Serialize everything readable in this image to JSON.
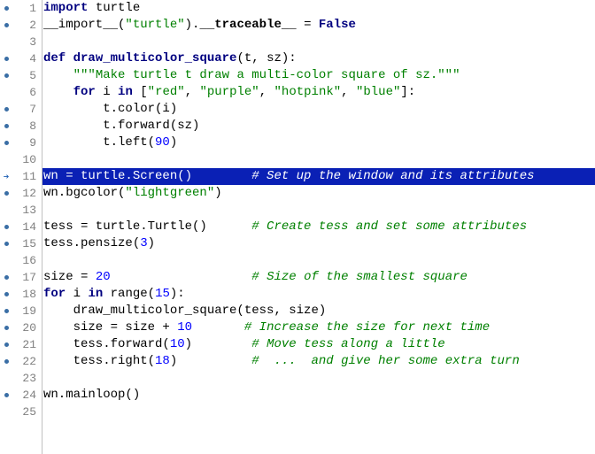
{
  "current_line": 11,
  "lines": [
    {
      "n": 1,
      "bp": true,
      "tokens": [
        [
          "k",
          "import"
        ],
        [
          "n",
          " turtle"
        ]
      ]
    },
    {
      "n": 2,
      "bp": true,
      "tokens": [
        [
          "n",
          "__import__("
        ],
        [
          "s",
          "\"turtle\""
        ],
        [
          "n",
          ")."
        ],
        [
          "bold",
          "__traceable__"
        ],
        [
          "n",
          " = "
        ],
        [
          "k",
          "False"
        ]
      ]
    },
    {
      "n": 3,
      "bp": false,
      "tokens": []
    },
    {
      "n": 4,
      "bp": true,
      "tokens": [
        [
          "k",
          "def"
        ],
        [
          "n",
          " "
        ],
        [
          "f",
          "draw_multicolor_square"
        ],
        [
          "n",
          "(t, sz):"
        ]
      ]
    },
    {
      "n": 5,
      "bp": true,
      "tokens": [
        [
          "n",
          "    "
        ],
        [
          "s",
          "\"\"\"Make turtle t draw a multi-color square of sz.\"\"\""
        ]
      ]
    },
    {
      "n": 6,
      "bp": false,
      "tokens": [
        [
          "n",
          "    "
        ],
        [
          "k",
          "for"
        ],
        [
          "n",
          " i "
        ],
        [
          "k",
          "in"
        ],
        [
          "n",
          " ["
        ],
        [
          "s",
          "\"red\""
        ],
        [
          "n",
          ", "
        ],
        [
          "s",
          "\"purple\""
        ],
        [
          "n",
          ", "
        ],
        [
          "s",
          "\"hotpink\""
        ],
        [
          "n",
          ", "
        ],
        [
          "s",
          "\"blue\""
        ],
        [
          "n",
          "]:"
        ]
      ]
    },
    {
      "n": 7,
      "bp": true,
      "tokens": [
        [
          "n",
          "        t.color(i)"
        ]
      ]
    },
    {
      "n": 8,
      "bp": true,
      "tokens": [
        [
          "n",
          "        t.forward(sz)"
        ]
      ]
    },
    {
      "n": 9,
      "bp": true,
      "tokens": [
        [
          "n",
          "        t.left("
        ],
        [
          "num",
          "90"
        ],
        [
          "n",
          ")"
        ]
      ]
    },
    {
      "n": 10,
      "bp": false,
      "tokens": []
    },
    {
      "n": 11,
      "bp": false,
      "hl": true,
      "tokens": [
        [
          "n",
          "wn = turtle.Screen()        "
        ],
        [
          "c",
          "# Set up the window and its attributes"
        ]
      ]
    },
    {
      "n": 12,
      "bp": true,
      "tokens": [
        [
          "n",
          "wn.bgcolor("
        ],
        [
          "s",
          "\"lightgreen\""
        ],
        [
          "n",
          ")"
        ]
      ]
    },
    {
      "n": 13,
      "bp": false,
      "tokens": []
    },
    {
      "n": 14,
      "bp": true,
      "tokens": [
        [
          "n",
          "tess = turtle.Turtle()      "
        ],
        [
          "c",
          "# Create tess and set some attributes"
        ]
      ]
    },
    {
      "n": 15,
      "bp": true,
      "tokens": [
        [
          "n",
          "tess.pensize("
        ],
        [
          "num",
          "3"
        ],
        [
          "n",
          ")"
        ]
      ]
    },
    {
      "n": 16,
      "bp": false,
      "tokens": []
    },
    {
      "n": 17,
      "bp": true,
      "tokens": [
        [
          "n",
          "size = "
        ],
        [
          "num",
          "20"
        ],
        [
          "n",
          "                   "
        ],
        [
          "c",
          "# Size of the smallest square"
        ]
      ]
    },
    {
      "n": 18,
      "bp": true,
      "tokens": [
        [
          "k",
          "for"
        ],
        [
          "n",
          " i "
        ],
        [
          "k",
          "in"
        ],
        [
          "n",
          " range("
        ],
        [
          "num",
          "15"
        ],
        [
          "n",
          "):"
        ]
      ]
    },
    {
      "n": 19,
      "bp": true,
      "tokens": [
        [
          "n",
          "    draw_multicolor_square(tess, size)"
        ]
      ]
    },
    {
      "n": 20,
      "bp": true,
      "tokens": [
        [
          "n",
          "    size = size + "
        ],
        [
          "num",
          "10"
        ],
        [
          "n",
          "       "
        ],
        [
          "c",
          "# Increase the size for next time"
        ]
      ]
    },
    {
      "n": 21,
      "bp": true,
      "tokens": [
        [
          "n",
          "    tess.forward("
        ],
        [
          "num",
          "10"
        ],
        [
          "n",
          ")        "
        ],
        [
          "c",
          "# Move tess along a little"
        ]
      ]
    },
    {
      "n": 22,
      "bp": true,
      "tokens": [
        [
          "n",
          "    tess.right("
        ],
        [
          "num",
          "18"
        ],
        [
          "n",
          ")          "
        ],
        [
          "c",
          "#  ...  and give her some extra turn"
        ]
      ]
    },
    {
      "n": 23,
      "bp": false,
      "tokens": []
    },
    {
      "n": 24,
      "bp": true,
      "tokens": [
        [
          "n",
          "wn.mainloop()"
        ]
      ]
    },
    {
      "n": 25,
      "bp": false,
      "tokens": []
    }
  ]
}
